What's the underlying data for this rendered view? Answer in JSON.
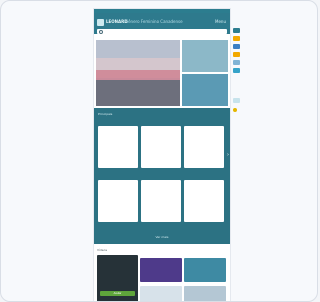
{
  "header": {
    "brand": "LEONARD",
    "tagline": "Gênero Feminino Canadense",
    "link": "Menu"
  },
  "search": {
    "placeholder": ""
  },
  "hero": {
    "main_caption": "",
    "side_captions": [
      "",
      ""
    ]
  },
  "section": {
    "title": "Principais",
    "more": "",
    "button": "Ver mais",
    "cards": [
      {
        "tag": "",
        "title": "",
        "meta": ""
      },
      {
        "tag": "",
        "title": "",
        "meta": ""
      },
      {
        "tag": "",
        "title": "",
        "meta": ""
      },
      {
        "tag": "",
        "title": "",
        "meta": ""
      },
      {
        "tag": "",
        "title": "",
        "meta": ""
      },
      {
        "tag": "",
        "title": "",
        "meta": ""
      }
    ]
  },
  "videos": {
    "label": "Vídeos",
    "items": [
      "",
      "",
      "",
      ""
    ]
  },
  "cookie": {
    "text": "",
    "accept": "Aceitar"
  },
  "colors": {
    "header": "#2e7a8d",
    "section": "#2c7283",
    "accept": "#5fa53b",
    "side_icons": [
      "#2c7d8f",
      "#f2a900",
      "#3b7fc4",
      "#f2a900",
      "#7fb3d5",
      "#35a3c9",
      "#c7e3ec",
      "#e4b600"
    ]
  },
  "icons": [
    "search-icon",
    "logo-icon",
    "chevron-right-icon"
  ]
}
